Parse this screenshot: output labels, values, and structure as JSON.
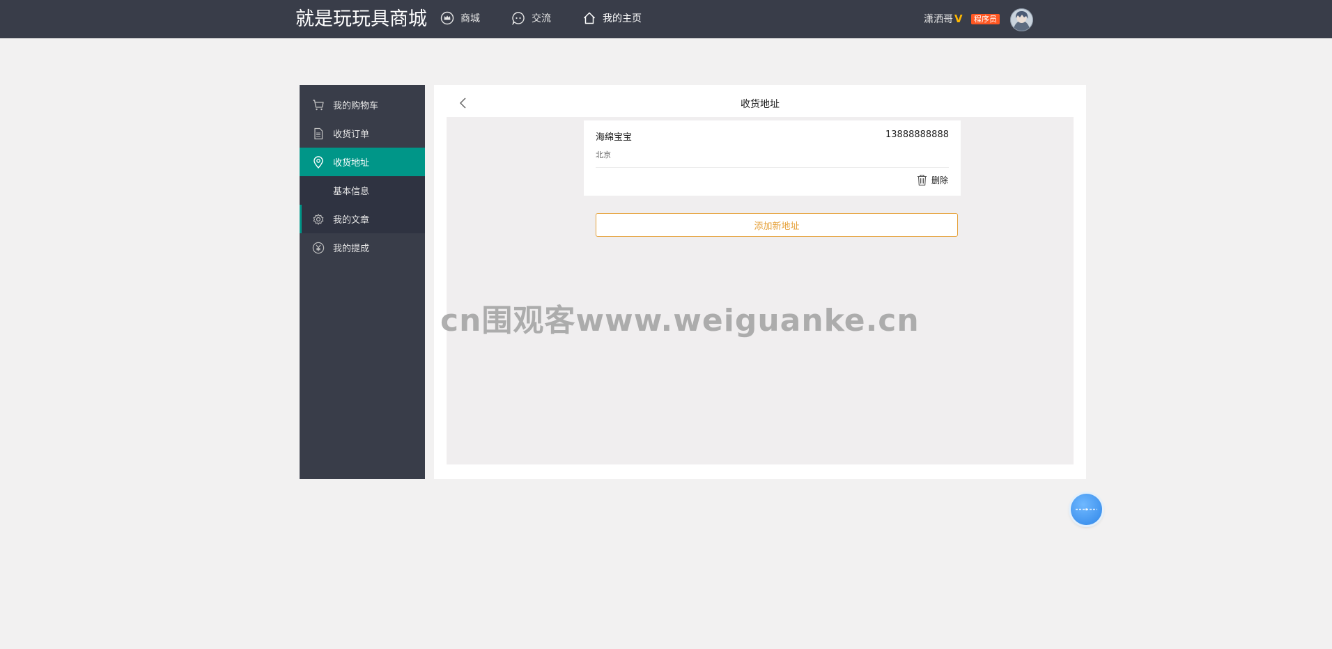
{
  "header": {
    "logo": "就是玩玩具商城",
    "nav": [
      {
        "label": "商城",
        "icon": "crown-icon"
      },
      {
        "label": "交流",
        "icon": "chat-icon"
      },
      {
        "label": "我的主页",
        "icon": "home-icon"
      }
    ],
    "user": {
      "name": "潇洒哥",
      "vip": "V",
      "badge": "程序员"
    }
  },
  "sidebar": {
    "items": [
      {
        "label": "我的购物车",
        "icon": "cart-icon"
      },
      {
        "label": "收货订单",
        "icon": "document-icon"
      },
      {
        "label": "收货地址",
        "icon": "location-icon"
      },
      {
        "label": "基本信息"
      },
      {
        "label": "我的文章",
        "icon": "gear-icon"
      },
      {
        "label": "我的提成",
        "icon": "yen-icon"
      }
    ]
  },
  "main": {
    "title": "收货地址",
    "address": {
      "name": "海绵宝宝",
      "phone": "13888888888",
      "detail": "北京",
      "delete_label": "删除"
    },
    "add_label": "添加新地址"
  },
  "watermark": "cn围观客www.weiguanke.cn",
  "colors": {
    "header_bg": "#393d49",
    "accent": "#009688",
    "badge": "#ff5722",
    "vip": "#ffb800",
    "add_button": "#e6a23c"
  }
}
